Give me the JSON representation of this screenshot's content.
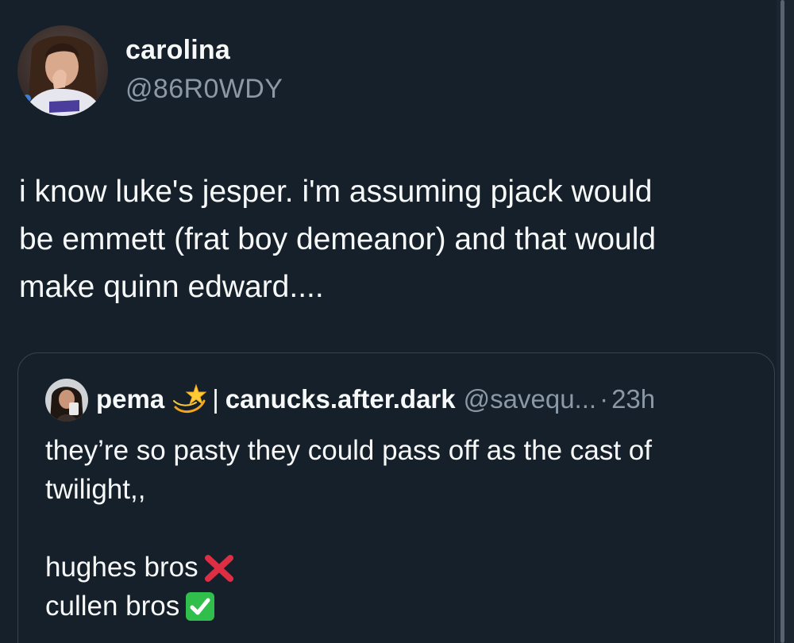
{
  "tweet": {
    "author_name": "carolina",
    "author_handle": "@86R0WDY",
    "text": "i know luke's jesper. i'm assuming pjack would\nbe emmett (frat boy demeanor) and that would\nmake quinn edward...."
  },
  "quoted_tweet": {
    "author_name": "pema",
    "name_emoji": "dizzy-star-emoji",
    "separator": "|",
    "display_org": "canucks.after.dark",
    "handle": "@savequ...",
    "dot": "·",
    "time": "23h",
    "text_line_1": "they’re so pasty they could pass off as the cast of",
    "text_line_2": "twilight,,",
    "text_line_3": "hughes bros",
    "text_line_4": "cullen bros",
    "line_3_emoji": "red-cross-mark-emoji",
    "line_4_emoji": "green-check-mark-emoji"
  },
  "colors": {
    "background": "#15202b",
    "primary_text": "#f7f9f9",
    "secondary_text": "#8b98a5",
    "border": "#38444d",
    "cross": "#dd2e44",
    "check": "#2fbf4a"
  }
}
